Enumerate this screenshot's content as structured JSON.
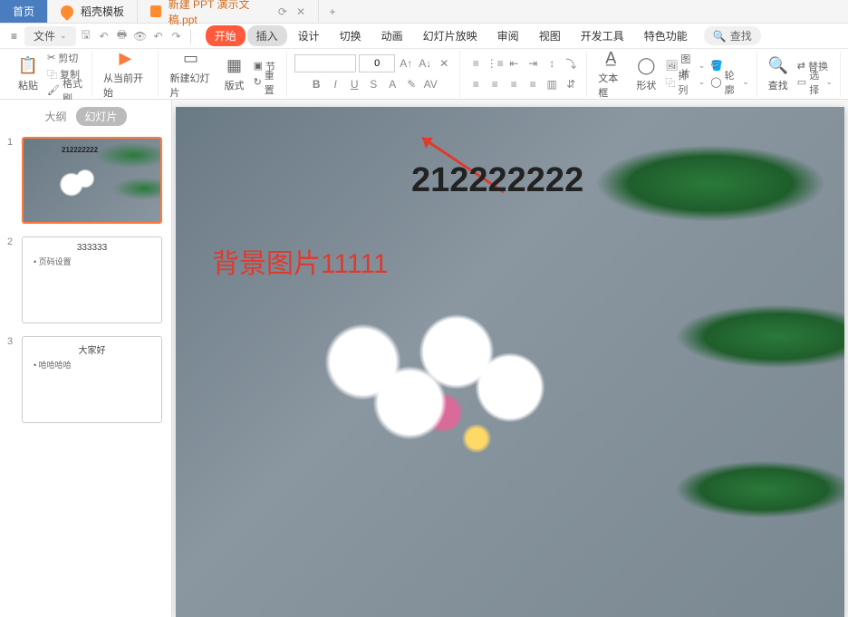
{
  "titleTabs": {
    "home": "首页",
    "template": "稻壳模板",
    "doc": "新建 PPT 演示文稿.ppt",
    "add": "+"
  },
  "menuBar": {
    "file": "文件",
    "search": "查找"
  },
  "ribbon": {
    "start": "开始",
    "insert": "插入",
    "design": "设计",
    "transition": "切换",
    "animation": "动画",
    "slideshow": "幻灯片放映",
    "review": "审阅",
    "view": "视图",
    "devtools": "开发工具",
    "feature": "特色功能"
  },
  "toolbar": {
    "paste": "粘贴",
    "cut": "剪切",
    "copy": "复制",
    "formatPainter": "格式刷",
    "fromCurrent": "从当前开始",
    "newSlide": "新建幻灯片",
    "layout": "版式",
    "section": "节",
    "reset": "重置",
    "fontSize": "0",
    "textbox": "文本框",
    "shape": "形状",
    "image": "图片",
    "arrange": "排列",
    "outline": "轮廓",
    "find": "查找",
    "replace": "替换",
    "select": "选择"
  },
  "sidebar": {
    "outline": "大纲",
    "slides": "幻灯片"
  },
  "thumbs": [
    {
      "num": "1",
      "overlay": "212222222"
    },
    {
      "num": "2",
      "title": "333333",
      "bullet": "页码设置"
    },
    {
      "num": "3",
      "title": "大家好",
      "bullet": "哈哈哈哈"
    }
  ],
  "slideCanvas": {
    "text1": "212222222",
    "text2": "背景图片11111"
  }
}
